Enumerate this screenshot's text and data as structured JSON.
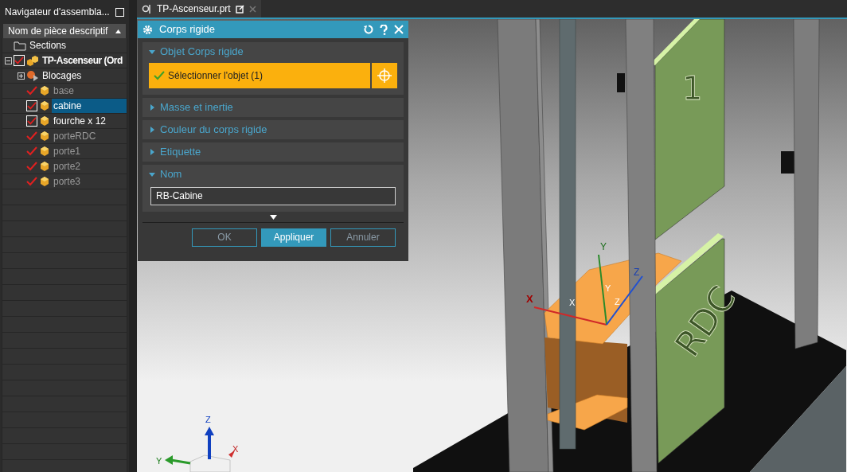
{
  "navigator": {
    "title": "Navigateur d'assembla...",
    "column_header": "Nom de pièce descriptif",
    "tree": [
      {
        "kind": "folder",
        "label": "Sections",
        "selected": false
      },
      {
        "kind": "assembly",
        "label": "TP-Ascenseur (Ord",
        "checked": true,
        "dimmed": false,
        "expanded": true,
        "selected": false,
        "children": [
          {
            "kind": "constraints",
            "label": "Blocages",
            "expanded": false,
            "selected": false
          },
          {
            "kind": "part",
            "label": "base",
            "checked": true,
            "dimmed": true,
            "selected": false
          },
          {
            "kind": "part",
            "label": "cabine",
            "checked": true,
            "dimmed": false,
            "selected": true
          },
          {
            "kind": "part",
            "label": "fourche x 12",
            "checked": true,
            "dimmed": false,
            "selected": false
          },
          {
            "kind": "part",
            "label": "porteRDC",
            "checked": true,
            "dimmed": true,
            "selected": false
          },
          {
            "kind": "part",
            "label": "porte1",
            "checked": true,
            "dimmed": true,
            "selected": false
          },
          {
            "kind": "part",
            "label": "porte2",
            "checked": true,
            "dimmed": true,
            "selected": false
          },
          {
            "kind": "part",
            "label": "porte3",
            "checked": true,
            "dimmed": true,
            "selected": false
          }
        ]
      }
    ]
  },
  "tabs": [
    {
      "title": "TP-Ascenseur.prt",
      "selected": true
    }
  ],
  "dialog": {
    "title": "Corps rigide",
    "sections": [
      {
        "title": "Objet Corps rigide",
        "expanded": true,
        "kind": "selection",
        "selection": {
          "label": "Sélectionner l'objet (1)",
          "done": true
        }
      },
      {
        "title": "Masse et inertie",
        "expanded": false
      },
      {
        "title": "Couleur du corps rigide",
        "expanded": false
      },
      {
        "title": "Etiquette",
        "expanded": false
      },
      {
        "title": "Nom",
        "expanded": true,
        "kind": "text",
        "value": "RB-Cabine"
      }
    ],
    "buttons": [
      {
        "label": "OK",
        "kind": "secondary"
      },
      {
        "label": "Appliquer",
        "kind": "primary"
      },
      {
        "label": "Annuler",
        "kind": "secondary"
      }
    ]
  },
  "viewport": {
    "panel_labels": [
      "1",
      "RDC"
    ],
    "cabin_axes": [
      "X",
      "Y",
      "Z"
    ],
    "cabin_axes_ghost": [
      "X",
      "Y",
      "Z"
    ],
    "view_triad": [
      "X",
      "Y",
      "Z"
    ]
  }
}
